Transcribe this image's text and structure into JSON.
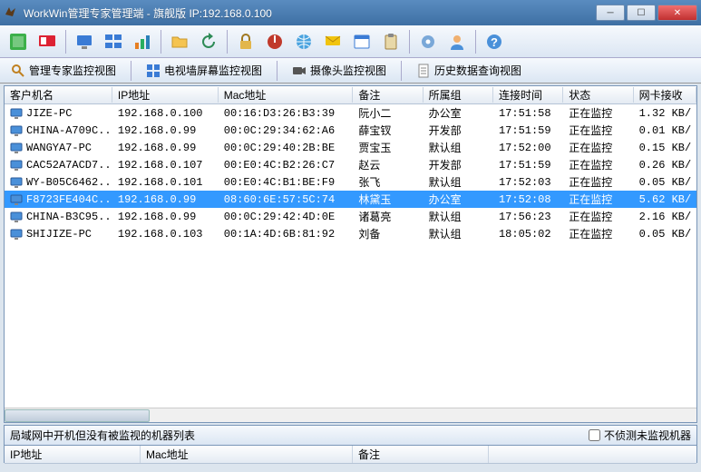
{
  "window": {
    "title": "WorkWin管理专家管理端 - 旗舰版 IP:192.168.0.100"
  },
  "tabs": {
    "t1": "管理专家监控视图",
    "t2": "电视墙屏幕监控视图",
    "t3": "摄像头监控视图",
    "t4": "历史数据查询视图"
  },
  "columns": {
    "c0": "客户机名",
    "c1": "IP地址",
    "c2": "Mac地址",
    "c3": "备注",
    "c4": "所属组",
    "c5": "连接时间",
    "c6": "状态",
    "c7": "网卡接收"
  },
  "rows": [
    {
      "name": "JIZE-PC",
      "ip": "192.168.0.100",
      "mac": "00:16:D3:26:B3:39",
      "note": "阮小二",
      "group": "办公室",
      "time": "17:51:58",
      "status": "正在监控",
      "net": "1.32 KB/",
      "selected": false
    },
    {
      "name": "CHINA-A709C...",
      "ip": "192.168.0.99",
      "mac": "00:0C:29:34:62:A6",
      "note": "薛宝钗",
      "group": "开发部",
      "time": "17:51:59",
      "status": "正在监控",
      "net": "0.01 KB/",
      "selected": false
    },
    {
      "name": "WANGYA7-PC",
      "ip": "192.168.0.99",
      "mac": "00:0C:29:40:2B:BE",
      "note": "贾宝玉",
      "group": "默认组",
      "time": "17:52:00",
      "status": "正在监控",
      "net": "0.15 KB/",
      "selected": false
    },
    {
      "name": "CAC52A7ACD7...",
      "ip": "192.168.0.107",
      "mac": "00:E0:4C:B2:26:C7",
      "note": "赵云",
      "group": "开发部",
      "time": "17:51:59",
      "status": "正在监控",
      "net": "0.26 KB/",
      "selected": false
    },
    {
      "name": "WY-B05C6462...",
      "ip": "192.168.0.101",
      "mac": "00:E0:4C:B1:BE:F9",
      "note": "张飞",
      "group": "默认组",
      "time": "17:52:03",
      "status": "正在监控",
      "net": "0.05 KB/",
      "selected": false
    },
    {
      "name": "F8723FE404C...",
      "ip": "192.168.0.99",
      "mac": "08:60:6E:57:5C:74",
      "note": "林黛玉",
      "group": "办公室",
      "time": "17:52:08",
      "status": "正在监控",
      "net": "5.62 KB/",
      "selected": true
    },
    {
      "name": "CHINA-B3C95...",
      "ip": "192.168.0.99",
      "mac": "00:0C:29:42:4D:0E",
      "note": "诸葛亮",
      "group": "默认组",
      "time": "17:56:23",
      "status": "正在监控",
      "net": "2.16 KB/",
      "selected": false
    },
    {
      "name": "SHIJIZE-PC",
      "ip": "192.168.0.103",
      "mac": "00:1A:4D:6B:81:92",
      "note": "刘备",
      "group": "默认组",
      "time": "18:05:02",
      "status": "正在监控",
      "net": "0.05 KB/",
      "selected": false
    }
  ],
  "bottom": {
    "title": "局域网中开机但没有被监视的机器列表",
    "checkbox": "不侦测未监视机器",
    "cols": {
      "c0": "IP地址",
      "c1": "Mac地址",
      "c2": "备注"
    }
  }
}
